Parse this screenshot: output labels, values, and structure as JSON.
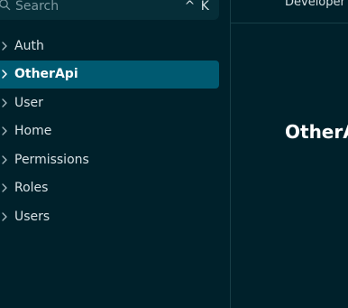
{
  "search": {
    "placeholder": "Search",
    "shortcut": "^ K"
  },
  "sidebar": {
    "items": [
      {
        "label": "Auth",
        "active": false
      },
      {
        "label": "OtherApi",
        "active": true
      },
      {
        "label": "User",
        "active": false
      },
      {
        "label": "Home",
        "active": false
      },
      {
        "label": "Permissions",
        "active": false
      },
      {
        "label": "Roles",
        "active": false
      },
      {
        "label": "Users",
        "active": false
      }
    ]
  },
  "header": {
    "nav_link": "Developer"
  },
  "main": {
    "title": "OtherApi"
  },
  "colors": {
    "background": "#00212b",
    "search_bg": "#062e38",
    "active_item_bg": "#005a71",
    "divider": "#173e47",
    "text": "#d7e1e5",
    "text_active": "#ffffff"
  },
  "icons": {
    "search": "search-icon",
    "chevron": "chevron-right-icon"
  }
}
